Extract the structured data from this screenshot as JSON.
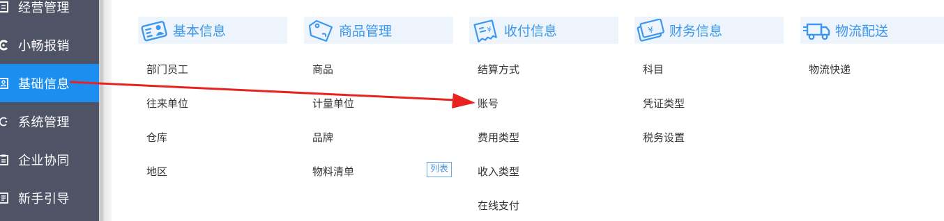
{
  "sidebar": {
    "items": [
      {
        "label": "经营管理",
        "icon": "document-icon",
        "active": false
      },
      {
        "label": "小畅报销",
        "icon": "reimburse-icon",
        "active": false
      },
      {
        "label": "基础信息",
        "icon": "id-card-icon",
        "active": true
      },
      {
        "label": "系统管理",
        "icon": "settings-icon",
        "active": false
      },
      {
        "label": "企业协同",
        "icon": "clipboard-icon",
        "active": false
      },
      {
        "label": "新手引导",
        "icon": "guide-icon",
        "active": false
      }
    ]
  },
  "columns": [
    {
      "title": "基本信息",
      "icon": "id-card-icon",
      "items": [
        "部门员工",
        "往来单位",
        "仓库",
        "地区"
      ]
    },
    {
      "title": "商品管理",
      "icon": "tag-icon",
      "items": [
        "商品",
        "计量单位",
        "品牌",
        "物料清单"
      ],
      "badge": "列表"
    },
    {
      "title": "收付信息",
      "icon": "receipt-icon",
      "items": [
        "结算方式",
        "账号",
        "费用类型",
        "收入类型",
        "在线支付"
      ]
    },
    {
      "title": "财务信息",
      "icon": "finance-card-icon",
      "items": [
        "科目",
        "凭证类型",
        "税务设置"
      ]
    },
    {
      "title": "物流配送",
      "icon": "truck-icon",
      "items": [
        "物流快递"
      ]
    }
  ],
  "colors": {
    "sidebar_bg": "#4f5366",
    "sidebar_active": "#1b8ef0",
    "header_bg": "#edf4fc",
    "header_text": "#3c97ee",
    "arrow": "#e8231f"
  }
}
